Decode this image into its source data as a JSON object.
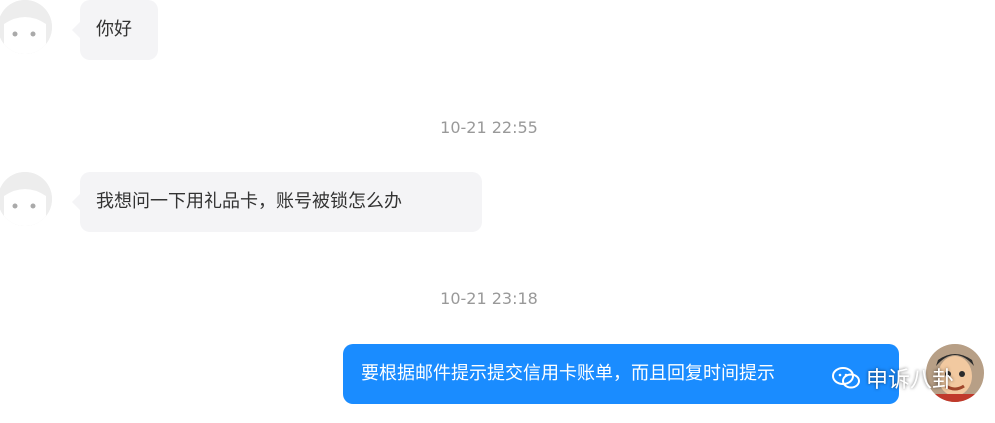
{
  "messages": [
    {
      "text": "你好"
    },
    {
      "timestamp": "10-21 22:55"
    },
    {
      "text": "我想问一下用礼品卡，账号被锁怎么办"
    },
    {
      "timestamp": "10-21 23:18"
    },
    {
      "text": "要根据邮件提示提交信用卡账单，而且回复时间提示"
    }
  ],
  "watermark": {
    "text": "申诉八卦",
    "icon": "wechat-icon"
  },
  "colors": {
    "incoming_bubble": "#f4f4f6",
    "outgoing_bubble": "#1a8cff",
    "timestamp": "#999999"
  }
}
